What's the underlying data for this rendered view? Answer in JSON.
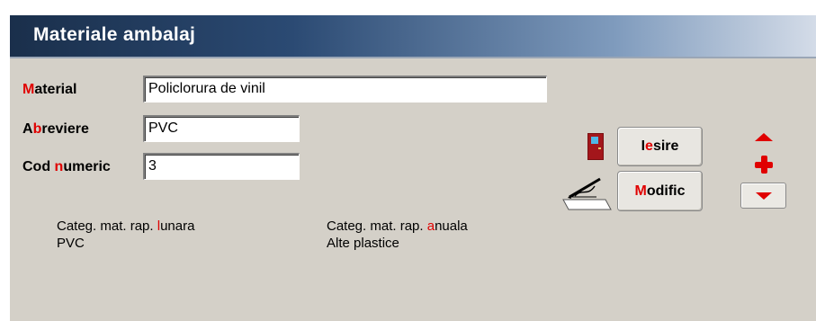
{
  "window": {
    "title": "Materiale ambalaj"
  },
  "form": {
    "material": {
      "label_hot": "M",
      "label_rest": "aterial",
      "value": "Policlorura de vinil"
    },
    "abreviere": {
      "label_pre": "A",
      "label_hot": "b",
      "label_rest": "reviere",
      "value": "PVC"
    },
    "cod_numeric": {
      "label_pre": "Cod ",
      "label_hot": "n",
      "label_rest": "umeric",
      "value": "3"
    }
  },
  "buttons": {
    "iesire": {
      "pre": "I",
      "hot": "e",
      "rest": "sire"
    },
    "modific": {
      "hot": "M",
      "rest": "odific"
    }
  },
  "info": {
    "lunara": {
      "label_pre": "Categ. mat. rap. ",
      "label_hot": "l",
      "label_rest": "unara",
      "value": "PVC"
    },
    "anuala": {
      "label_pre": "Categ. mat. rap. ",
      "label_hot": "a",
      "label_rest": "nuala",
      "value": "Alte plastice"
    }
  },
  "icons": {
    "exit": "door-icon",
    "edit": "pen-paper-icon",
    "up": "arrow-up-icon",
    "add": "plus-icon",
    "down": "arrow-down-icon"
  },
  "colors": {
    "hotkey": "#e00000",
    "window_bg": "#d4d0c8",
    "title_dark": "#1a2f4b"
  }
}
